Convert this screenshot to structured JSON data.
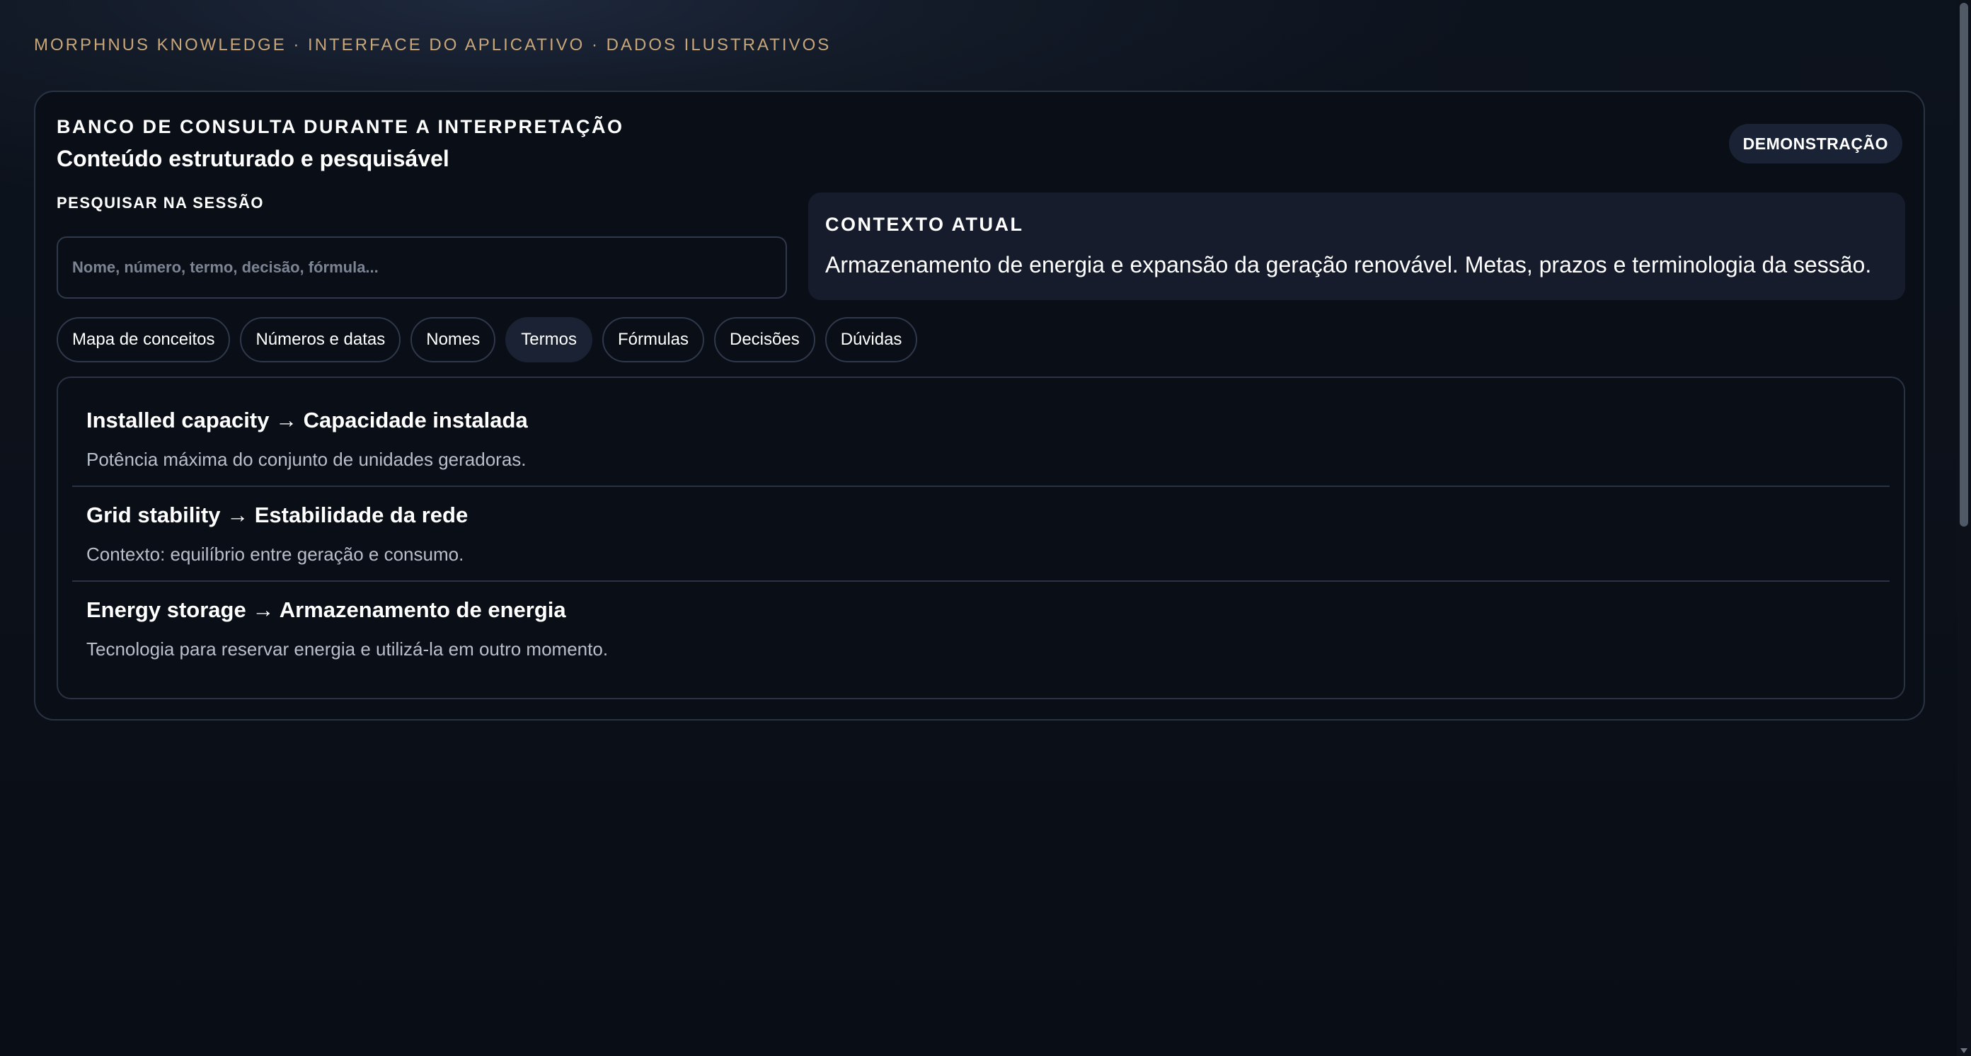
{
  "header": {
    "brand": "MORPHNUS KNOWLEDGE · INTERFACE DO APLICATIVO · DADOS ILUSTRATIVOS"
  },
  "panel": {
    "overline": "BANCO DE CONSULTA DURANTE A INTERPRETAÇÃO",
    "subtitle": "Conteúdo estruturado e pesquisável",
    "badge": "DEMONSTRAÇÃO"
  },
  "search": {
    "label": "PESQUISAR NA SESSÃO",
    "value": "",
    "placeholder": "Nome, número, termo, decisão, fórmula..."
  },
  "context": {
    "title": "CONTEXTO ATUAL",
    "text": "Armazenamento de energia e expansão da geração renovável. Metas, prazos e terminologia da sessão."
  },
  "tabs": [
    {
      "label": "Mapa de conceitos",
      "active": false
    },
    {
      "label": "Números e datas",
      "active": false
    },
    {
      "label": "Nomes",
      "active": false
    },
    {
      "label": "Termos",
      "active": true
    },
    {
      "label": "Fórmulas",
      "active": false
    },
    {
      "label": "Decisões",
      "active": false
    },
    {
      "label": "Dúvidas",
      "active": false
    }
  ],
  "terms": [
    {
      "title": "Installed capacity → Capacidade instalada",
      "description": "Potência máxima do conjunto de unidades geradoras."
    },
    {
      "title": "Grid stability → Estabilidade da rede",
      "description": "Contexto: equilíbrio entre geração e consumo."
    },
    {
      "title": "Energy storage → Armazenamento de energia",
      "description": "Tecnologia para reservar energia e utilizá-la em outro momento."
    }
  ],
  "colors": {
    "background": "#0b1019",
    "card": "#0a0f17",
    "border": "#2a3344",
    "brand_accent": "#c9a678",
    "context_bg": "#161c2c",
    "active_tab_bg": "#1b2233",
    "muted_text": "#b9bfca"
  }
}
